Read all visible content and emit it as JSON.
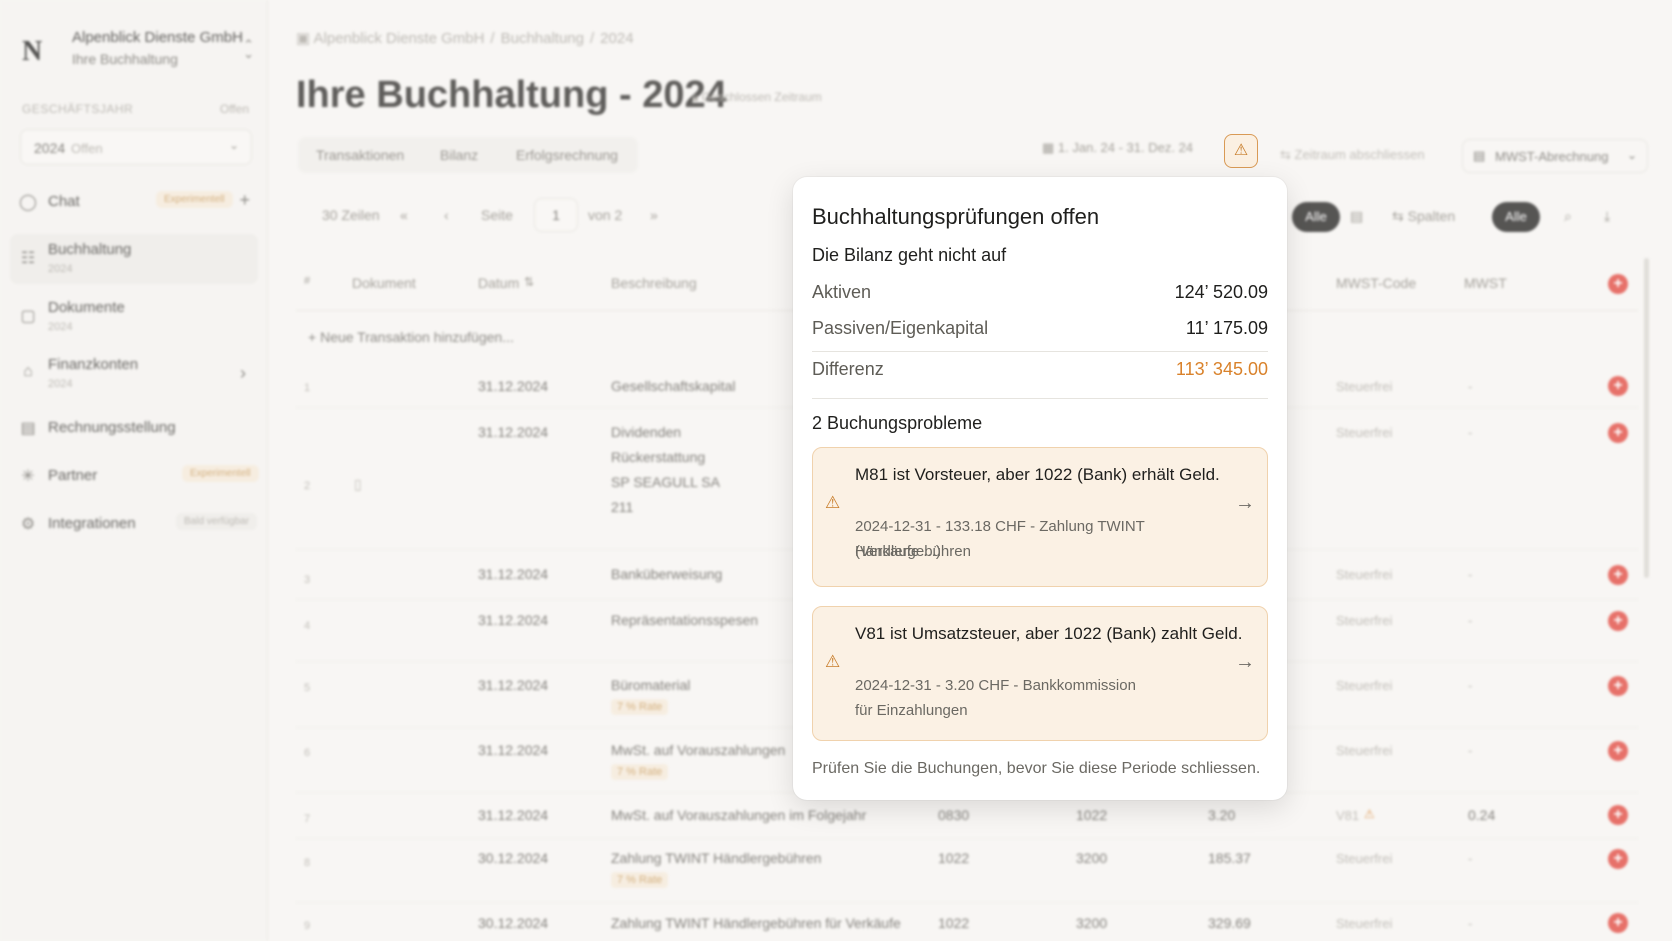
{
  "sidebar": {
    "logo": "N",
    "company_name": "Alpenblick Dienste GmbH",
    "company_sub": "Ihre Buchhaltung",
    "fiscal_year_label": "GESCHÄFTSJAHR",
    "fiscal_year_status": "Offen",
    "fiscal_year_value": "2024",
    "fiscal_year_value_status": "Offen",
    "items": [
      {
        "label": "Chat",
        "badge": "Experimentell"
      },
      {
        "label": "Buchhaltung",
        "sub": "2024"
      },
      {
        "label": "Dokumente",
        "sub": "2024"
      },
      {
        "label": "Finanzkonten",
        "sub": "2024"
      },
      {
        "label": "Rechnungsstellung"
      },
      {
        "label": "Partner",
        "badge": "Experimentell"
      },
      {
        "label": "Integrationen",
        "badge": "Bald verfügbar"
      }
    ]
  },
  "header": {
    "breadcrumb": [
      "Alpenblick Dienste GmbH",
      "Buchhaltung",
      "2024"
    ],
    "title": "Ihre Buchhaltung - 2024",
    "closed_badge": "Geschlossen Zeitraum",
    "tabs": [
      "Transaktionen",
      "Bilanz",
      "Erfolgsrechnung"
    ],
    "date_range": "1. Jan. 24 - 31. Dez. 24",
    "close_period": "Zeitraum abschliessen",
    "vat_report": "MWST-Abrechnung"
  },
  "toolbar": {
    "rows": "30 Zeilen",
    "page_label": "Seite",
    "page_value": "1",
    "page_of": "von 2",
    "filter_all_1": "Alle",
    "columns": "Spalten",
    "filter_all_2": "Alle"
  },
  "table": {
    "headers": {
      "index": "#",
      "document": "Dokument",
      "date": "Datum",
      "description": "Beschreibung",
      "vat_code": "MWST-Code",
      "vat": "MWST"
    },
    "add_label": "Neue Transaktion hinzufügen...",
    "rows": [
      {
        "idx": "1",
        "date": "31.12.2024",
        "desc": "Gesellschaftskapital",
        "code": "Steuerfrei",
        "vat": "-"
      },
      {
        "idx": "2",
        "date": "31.12.2024",
        "desc": "Dividenden",
        "desc2": "Rückerstattung",
        "desc3": "SP SEAGULL SA",
        "desc4": "211",
        "code": "Steuerfrei",
        "vat": "-"
      },
      {
        "idx": "3",
        "date": "31.12.2024",
        "desc": "Banküberweisung",
        "code": "Steuerfrei",
        "vat": "-"
      },
      {
        "idx": "4",
        "date": "31.12.2024",
        "desc": "Repräsentationsspesen",
        "code": "Steuerfrei",
        "vat": "-"
      },
      {
        "idx": "5",
        "date": "31.12.2024",
        "desc": "Büromaterial",
        "rate": "7 % Rate",
        "code": "Steuerfrei",
        "vat": "-"
      },
      {
        "idx": "6",
        "date": "31.12.2024",
        "desc": "MwSt. auf Vorauszahlungen",
        "rate": "7 % Rate",
        "code": "Steuerfrei",
        "vat": "-"
      },
      {
        "idx": "7",
        "date": "31.12.2024",
        "desc": "MwSt. auf Vorauszahlungen im Folgejahr",
        "debit": "0830",
        "credit": "1022",
        "amount": "3.20",
        "code": "V81",
        "vat": "0.24"
      },
      {
        "idx": "8",
        "date": "30.12.2024",
        "desc": "Zahlung TWINT Händlergebühren",
        "rate": "7 % Rate",
        "debit": "1022",
        "credit": "3200",
        "amount": "185.37",
        "code": "Steuerfrei",
        "vat": "-"
      },
      {
        "idx": "9",
        "date": "30.12.2024",
        "desc": "Zahlung TWINT Händlergebühren für Verkäufe",
        "debit": "1022",
        "credit": "3200",
        "amount": "329.69",
        "code": "Steuerfrei",
        "vat": "-"
      }
    ]
  },
  "popover": {
    "title": "Buchhaltungsprüfungen offen",
    "subtitle": "Die Bilanz geht nicht auf",
    "assets_label": "Aktiven",
    "assets_value": "124’ 520.09",
    "liabilities_label": "Passiven/Eigenkapital",
    "liabilities_value": "11’ 175.09",
    "difference_label": "Differenz",
    "difference_value": "113’ 345.00",
    "issues_title": "2 Buchungsprobleme",
    "issues": [
      {
        "title": "M81 ist Vorsteuer, aber 1022 (Bank) erhält Geld.",
        "detail1": "2024-12-31 - 133.18 CHF - Zahlung TWINT Händlergebühren",
        "detail2": "(Verkäufe ...)"
      },
      {
        "title": "V81 ist Umsatzsteuer, aber 1022 (Bank) zahlt Geld.",
        "detail1": "2024-12-31 - 3.20 CHF - Bankkommission",
        "detail2": "für Einzahlungen"
      }
    ],
    "footer": "Prüfen Sie die Buchungen, bevor Sie diese Periode schliessen."
  },
  "colors": {
    "accent_orange": "#d9822b",
    "warning_bg": "#fbf1e4",
    "danger_red": "#e0443a"
  },
  "icons": [
    "warning-icon",
    "lock-icon",
    "calendar-icon",
    "chat-icon",
    "ledger-icon",
    "document-icon",
    "bank-icon",
    "invoice-icon",
    "partner-icon",
    "integration-icon",
    "arrow-right-icon",
    "search-icon",
    "download-icon",
    "plus-icon"
  ]
}
